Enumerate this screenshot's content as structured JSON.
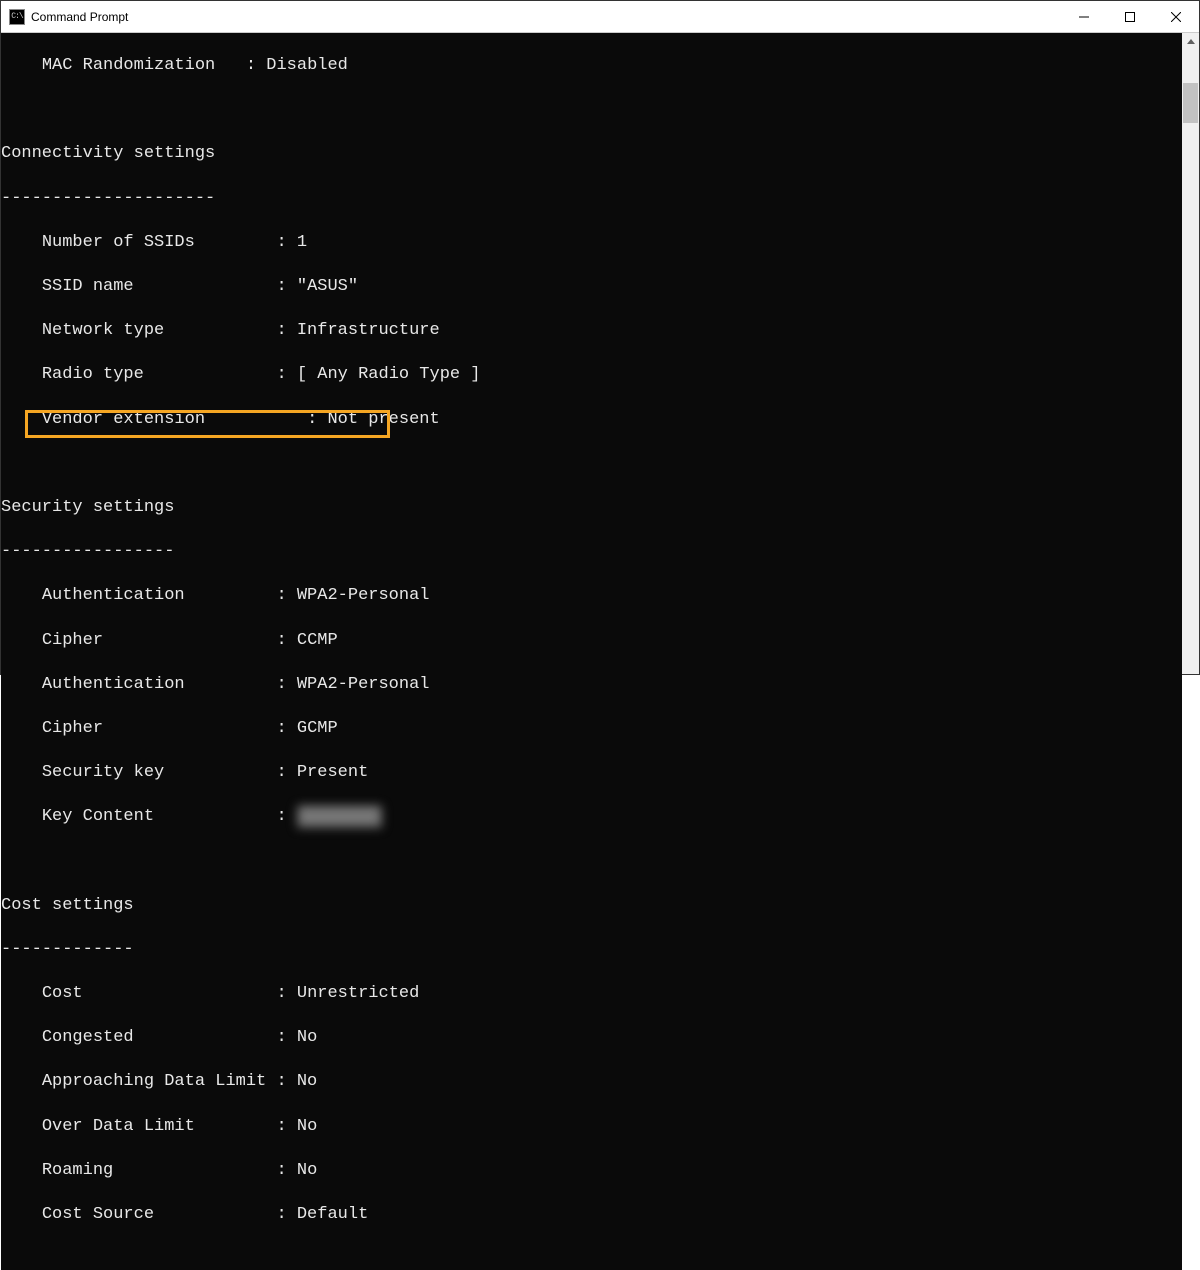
{
  "window": {
    "title": "Command Prompt",
    "icon_text": "C:\\"
  },
  "terminal": {
    "mac_randomization": {
      "label": "MAC Randomization",
      "value": "Disabled"
    },
    "connectivity": {
      "header": "Connectivity settings",
      "divider": "---------------------",
      "number_of_ssids": {
        "label": "Number of SSIDs",
        "value": "1"
      },
      "ssid_name": {
        "label": "SSID name",
        "value": "\"ASUS\""
      },
      "network_type": {
        "label": "Network type",
        "value": "Infrastructure"
      },
      "radio_type": {
        "label": "Radio type",
        "value": "[ Any Radio Type ]"
      },
      "vendor_extension": {
        "label": "Vendor extension",
        "value": "Not present"
      }
    },
    "security": {
      "header": "Security settings",
      "divider": "-----------------",
      "authentication1": {
        "label": "Authentication",
        "value": "WPA2-Personal"
      },
      "cipher1": {
        "label": "Cipher",
        "value": "CCMP"
      },
      "authentication2": {
        "label": "Authentication",
        "value": "WPA2-Personal"
      },
      "cipher2": {
        "label": "Cipher",
        "value": "GCMP"
      },
      "security_key": {
        "label": "Security key",
        "value": "Present"
      },
      "key_content": {
        "label": "Key Content",
        "value": "████████"
      }
    },
    "cost": {
      "header": "Cost settings",
      "divider": "-------------",
      "cost": {
        "label": "Cost",
        "value": "Unrestricted"
      },
      "congested": {
        "label": "Congested",
        "value": "No"
      },
      "approaching_limit": {
        "label": "Approaching Data Limit",
        "value": "No"
      },
      "over_limit": {
        "label": "Over Data Limit",
        "value": "No"
      },
      "roaming": {
        "label": "Roaming",
        "value": "No"
      },
      "cost_source": {
        "label": "Cost Source",
        "value": "Default"
      }
    }
  }
}
